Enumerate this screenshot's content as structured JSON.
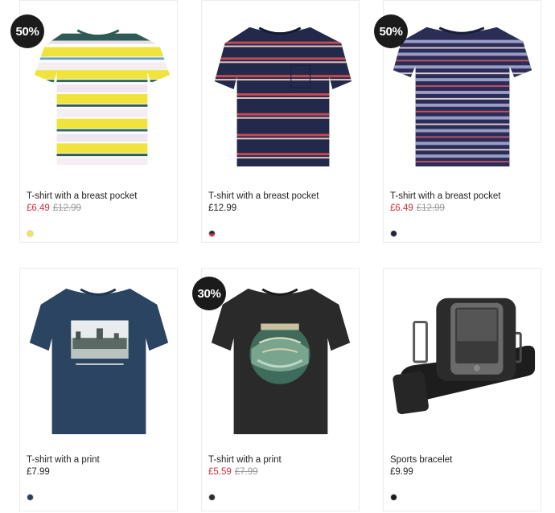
{
  "products": [
    {
      "title": "T-shirt with a breast pocket",
      "badge": "50%",
      "sale_price": "£6.49",
      "old_price": "£12.99",
      "swatch_color": "#f3e44a",
      "image": "yellow-striped-tshirt"
    },
    {
      "title": "T-shirt with a breast pocket",
      "badge": "",
      "price": "£12.99",
      "swatch_color": "#1f2740",
      "swatch_color_2": "#c3343c",
      "image": "navy-red-striped-tshirt"
    },
    {
      "title": "T-shirt with a breast pocket",
      "badge": "50%",
      "sale_price": "£6.49",
      "old_price": "£12.99",
      "swatch_color": "#1e2340",
      "image": "purple-patterned-striped-tshirt"
    },
    {
      "title": "T-shirt with a print",
      "badge": "",
      "price": "£7.99",
      "swatch_color": "#2a3f5c",
      "image": "navy-print-tshirt"
    },
    {
      "title": "T-shirt with a print",
      "badge": "30%",
      "sale_price": "£5.59",
      "old_price": "£7.99",
      "swatch_color": "#2b2b2b",
      "image": "black-print-tshirt"
    },
    {
      "title": "Sports bracelet",
      "badge": "",
      "price": "£9.99",
      "swatch_color": "#1c1c1c",
      "image": "sports-armband"
    }
  ],
  "colors": {
    "sale": "#d0303c",
    "old_price": "#999999",
    "badge_bg": "#1b1b1b"
  }
}
